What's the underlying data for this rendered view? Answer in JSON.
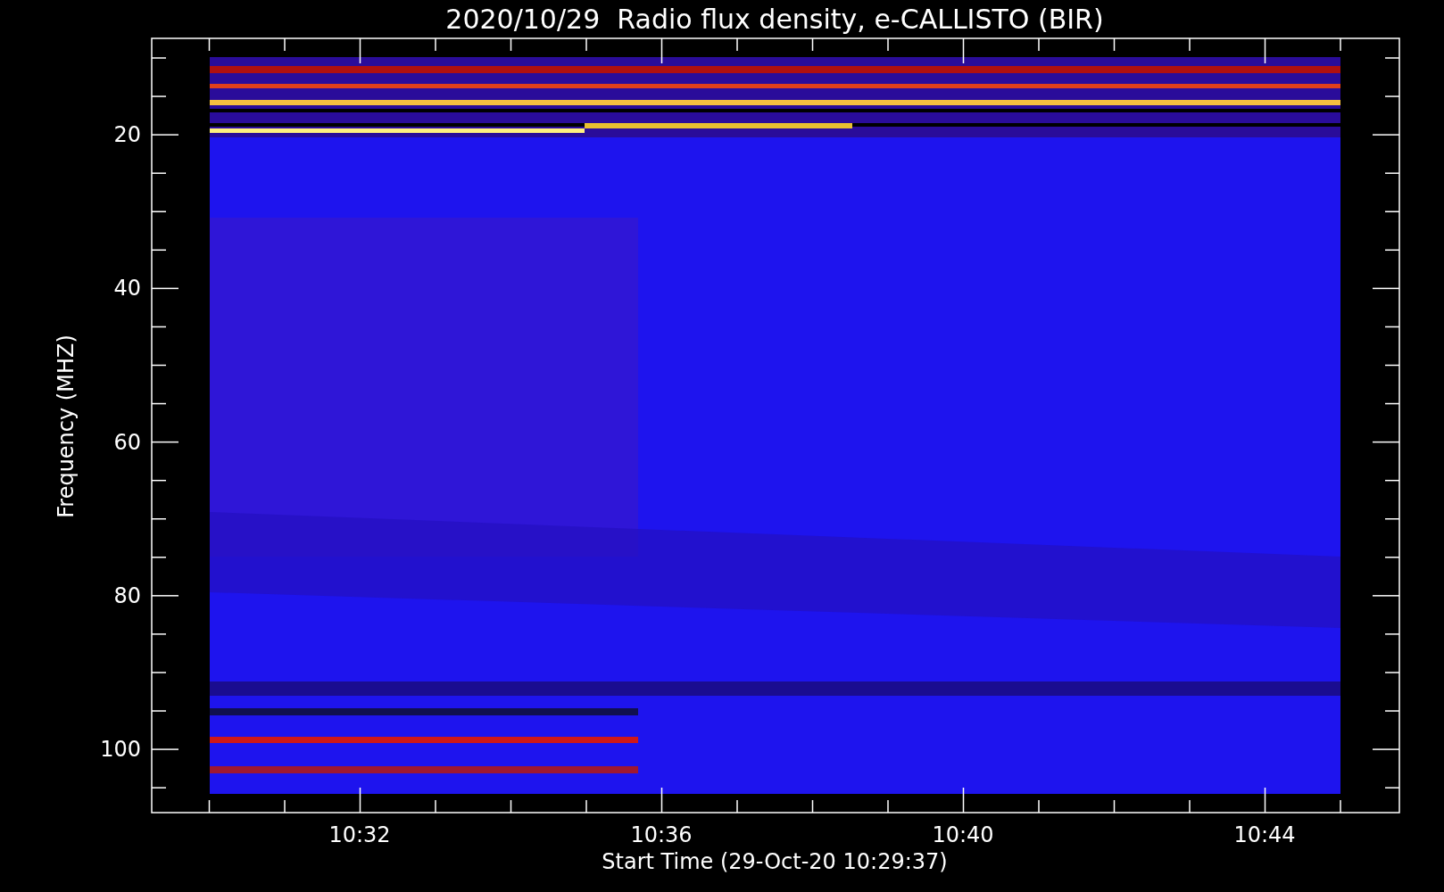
{
  "title": "2020/10/29  Radio flux density, e-CALLISTO (BIR)",
  "y_axis": {
    "label": "Frequency (MHZ)",
    "ticks": [
      "20",
      "40",
      "60",
      "80",
      "100"
    ]
  },
  "x_axis": {
    "label": "Start Time (29-Oct-20 10:29:37)",
    "ticks": [
      "10:32",
      "10:36",
      "10:40",
      "10:44"
    ]
  }
}
